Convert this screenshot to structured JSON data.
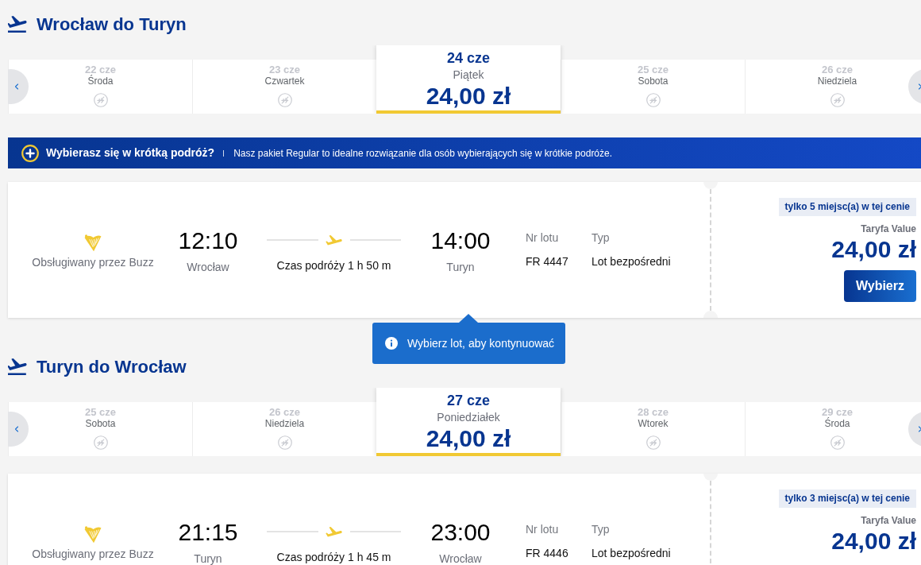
{
  "sections": [
    {
      "title": "Wrocław do Turyn",
      "dates": [
        {
          "date": "22 cze",
          "day": "Środa",
          "available": false,
          "selected": false
        },
        {
          "date": "23 cze",
          "day": "Czwartek",
          "available": false,
          "selected": false
        },
        {
          "date": "24 cze",
          "day": "Piątek",
          "price": "24,00 zł",
          "available": true,
          "selected": true
        },
        {
          "date": "25 cze",
          "day": "Sobota",
          "available": false,
          "selected": false
        },
        {
          "date": "26 cze",
          "day": "Niedziela",
          "available": false,
          "selected": false
        }
      ],
      "banner": {
        "title": "Wybierasz się w krótką podróż?",
        "text": "Nasz pakiet Regular to idealne rozwiązanie dla osób wybierających się w krótkie podróże."
      },
      "flight": {
        "operator": "Obsługiwany przez Buzz",
        "departure": {
          "time": "12:10",
          "city": "Wrocław"
        },
        "duration": "Czas podróży 1 h 50 m",
        "arrival": {
          "time": "14:00",
          "city": "Turyn"
        },
        "details": [
          {
            "label": "Nr lotu",
            "value": "FR 4447"
          },
          {
            "label": "Typ",
            "value": "Lot bezpośredni"
          }
        ],
        "seats_badge": "tylko 5 miejsc(a) w tej cenie",
        "fare": "Taryfa Value",
        "price": "24,00 zł",
        "button": "Wybierz"
      },
      "tooltip": "Wybierz lot, aby kontynuować"
    },
    {
      "title": "Turyn do Wrocław",
      "dates": [
        {
          "date": "25 cze",
          "day": "Sobota",
          "available": false,
          "selected": false
        },
        {
          "date": "26 cze",
          "day": "Niedziela",
          "available": false,
          "selected": false
        },
        {
          "date": "27 cze",
          "day": "Poniedziałek",
          "price": "24,00 zł",
          "available": true,
          "selected": true
        },
        {
          "date": "28 cze",
          "day": "Wtorek",
          "available": false,
          "selected": false
        },
        {
          "date": "29 cze",
          "day": "Środa",
          "available": false,
          "selected": false
        }
      ],
      "flight": {
        "operator": "Obsługiwany przez Buzz",
        "departure": {
          "time": "21:15",
          "city": "Turyn"
        },
        "duration": "Czas podróży 1 h 45 m",
        "arrival": {
          "time": "23:00",
          "city": "Wrocław"
        },
        "details": [
          {
            "label": "Nr lotu",
            "value": "FR 4446"
          },
          {
            "label": "Typ",
            "value": "Lot bezpośredni"
          }
        ],
        "seats_badge": "tylko 3 miejsc(a) w tej cenie",
        "fare": "Taryfa Value",
        "price": "24,00 zł"
      }
    }
  ]
}
